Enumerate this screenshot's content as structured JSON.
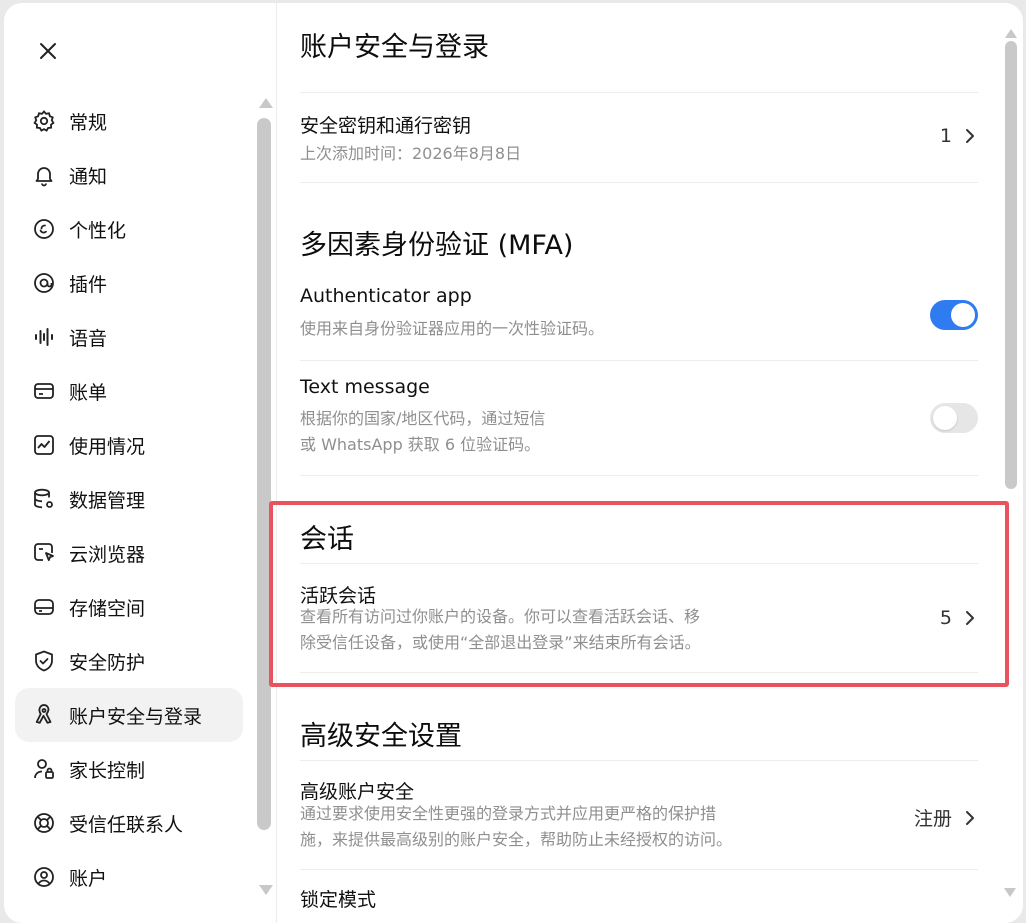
{
  "sidebar": {
    "close_icon": "close-icon",
    "items": [
      {
        "label": "常规",
        "icon": "gear-icon"
      },
      {
        "label": "通知",
        "icon": "bell-icon"
      },
      {
        "label": "个性化",
        "icon": "personalize-icon"
      },
      {
        "label": "插件",
        "icon": "plugin-icon"
      },
      {
        "label": "语音",
        "icon": "voice-wave-icon"
      },
      {
        "label": "账单",
        "icon": "card-icon"
      },
      {
        "label": "使用情况",
        "icon": "usage-chart-icon"
      },
      {
        "label": "数据管理",
        "icon": "database-icon"
      },
      {
        "label": "云浏览器",
        "icon": "cloud-browser-icon"
      },
      {
        "label": "存储空间",
        "icon": "storage-icon"
      },
      {
        "label": "安全防护",
        "icon": "shield-icon"
      },
      {
        "label": "账户安全与登录",
        "icon": "lock-ribbon-icon",
        "active": true
      },
      {
        "label": "家长控制",
        "icon": "parental-control-icon"
      },
      {
        "label": "受信任联系人",
        "icon": "lifebuoy-icon"
      },
      {
        "label": "账户",
        "icon": "user-circle-icon"
      }
    ]
  },
  "main": {
    "title": "账户安全与登录",
    "passkeys": {
      "title": "安全密钥和通行密钥",
      "desc": "上次添加时间：2026年8月8日",
      "count": "1"
    },
    "mfa": {
      "title": "多因素身份验证 (MFA)",
      "authenticator": {
        "title": "Authenticator app",
        "desc": "使用来自身份验证器应用的一次性验证码。",
        "enabled": true
      },
      "text_message": {
        "title": "Text message",
        "desc_line1": "根据你的国家/地区代码，通过短信",
        "desc_line2": "或 WhatsApp 获取 6 位验证码。",
        "enabled": false
      }
    },
    "sessions": {
      "title": "会话",
      "active": {
        "title": "活跃会话",
        "desc_line1": "查看所有访问过你账户的设备。你可以查看活跃会话、移",
        "desc_line2": "除受信任设备，或使用“全部退出登录”来结束所有会话。",
        "count": "5"
      }
    },
    "advanced": {
      "title": "高级安全设置",
      "account_security": {
        "title": "高级账户安全",
        "desc_line1": "通过要求使用安全性更强的登录方式并应用更严格的保护措",
        "desc_line2": "施，来提供最高级别的账户安全，帮助防止未经授权的访问。",
        "action": "注册"
      },
      "lockdown": {
        "title": "锁定模式"
      }
    }
  },
  "colors": {
    "toggle_on": "#2f7bf0",
    "highlight": "#e8535e"
  }
}
